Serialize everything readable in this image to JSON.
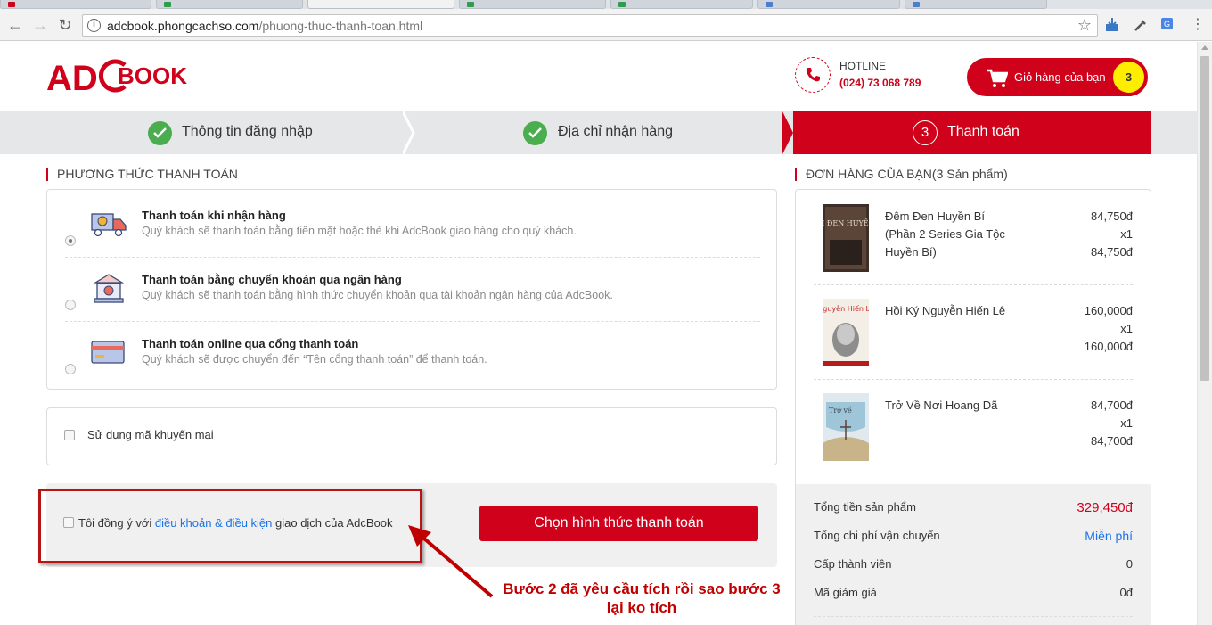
{
  "browser": {
    "url_host": "adcbook.phongcachso.com",
    "url_path": "/phuong-thuc-thanh-toan.html"
  },
  "header": {
    "logo_text": "ADCBOOK",
    "hotline_label": "HOTLINE",
    "hotline_number": "(024) 73 068 789",
    "cart_label": "Giỏ hàng của bạn",
    "cart_count": "3"
  },
  "steps": [
    {
      "label": "Thông tin đăng nhập",
      "state": "done"
    },
    {
      "label": "Địa chỉ nhận hàng",
      "state": "done"
    },
    {
      "number": "3",
      "label": "Thanh toán",
      "state": "active"
    }
  ],
  "payment": {
    "section_title": "PHƯƠNG THỨC THANH TOÁN",
    "options": [
      {
        "title": "Thanh toán khi nhận hàng",
        "desc": "Quý khách sẽ thanh toán bằng tiền mặt hoặc thẻ khi AdcBook giao hàng cho quý khách.",
        "icon": "delivery-truck-icon",
        "selected": true
      },
      {
        "title": "Thanh toán bằng chuyển khoản qua ngân hàng",
        "desc": "Quý khách sẽ thanh toán bằng hình thức chuyển khoản qua tài khoản ngân hàng của AdcBook.",
        "icon": "bank-icon",
        "selected": false
      },
      {
        "title": "Thanh toán online qua cổng thanh toán",
        "desc": "Quý khách sẽ được chuyển đến “Tên cổng thanh toán” để thanh toán.",
        "icon": "credit-card-icon",
        "selected": false
      }
    ],
    "promo_label": "Sử dụng mã khuyến mại",
    "agree_prefix": "Tôi đồng ý với ",
    "agree_link": "điều khoản & điều kiện",
    "agree_suffix": " giao dịch của AdcBook",
    "submit_label": "Chọn hình thức thanh toán"
  },
  "annotation": {
    "line1": "Bước 2 đã yêu cầu tích rồi sao bước 3",
    "line2": "lại ko tích",
    "color": "#c00000"
  },
  "order": {
    "section_title": "ĐƠN HÀNG CỦA BẠN(3 Sản phẩm)",
    "items": [
      {
        "name": "Đêm Đen Huyền Bí (Phần 2 Series Gia Tộc Huyền Bí)",
        "price": "84,750đ",
        "qty": "x1",
        "subtotal": "84,750đ",
        "cover_text": "ĐÊM ĐEN HUYỀN BÍ"
      },
      {
        "name": "Hồi Ký Nguyễn Hiến Lê",
        "price": "160,000đ",
        "qty": "x1",
        "subtotal": "160,000đ",
        "cover_text": "Nguyễn Hiến Lê"
      },
      {
        "name": "Trở Về Nơi Hoang Dã",
        "price": "84,700đ",
        "qty": "x1",
        "subtotal": "84,700đ",
        "cover_text": "Trở về"
      }
    ],
    "totals": [
      {
        "label": "Tổng tiền sản phẩm",
        "value": "329,450đ",
        "style": "red"
      },
      {
        "label": "Tổng chi phí vận chuyển",
        "value": "Miễn phí",
        "style": "blue"
      },
      {
        "label": "Cấp thành viên",
        "value": "0",
        "style": "plain"
      },
      {
        "label": "Mã giảm giá",
        "value": "0đ",
        "style": "plain"
      }
    ]
  },
  "colors": {
    "brand_red": "#d0021b",
    "success_green": "#4aae4e",
    "link_blue": "#1a73e8",
    "badge_yellow": "#ffed00"
  }
}
